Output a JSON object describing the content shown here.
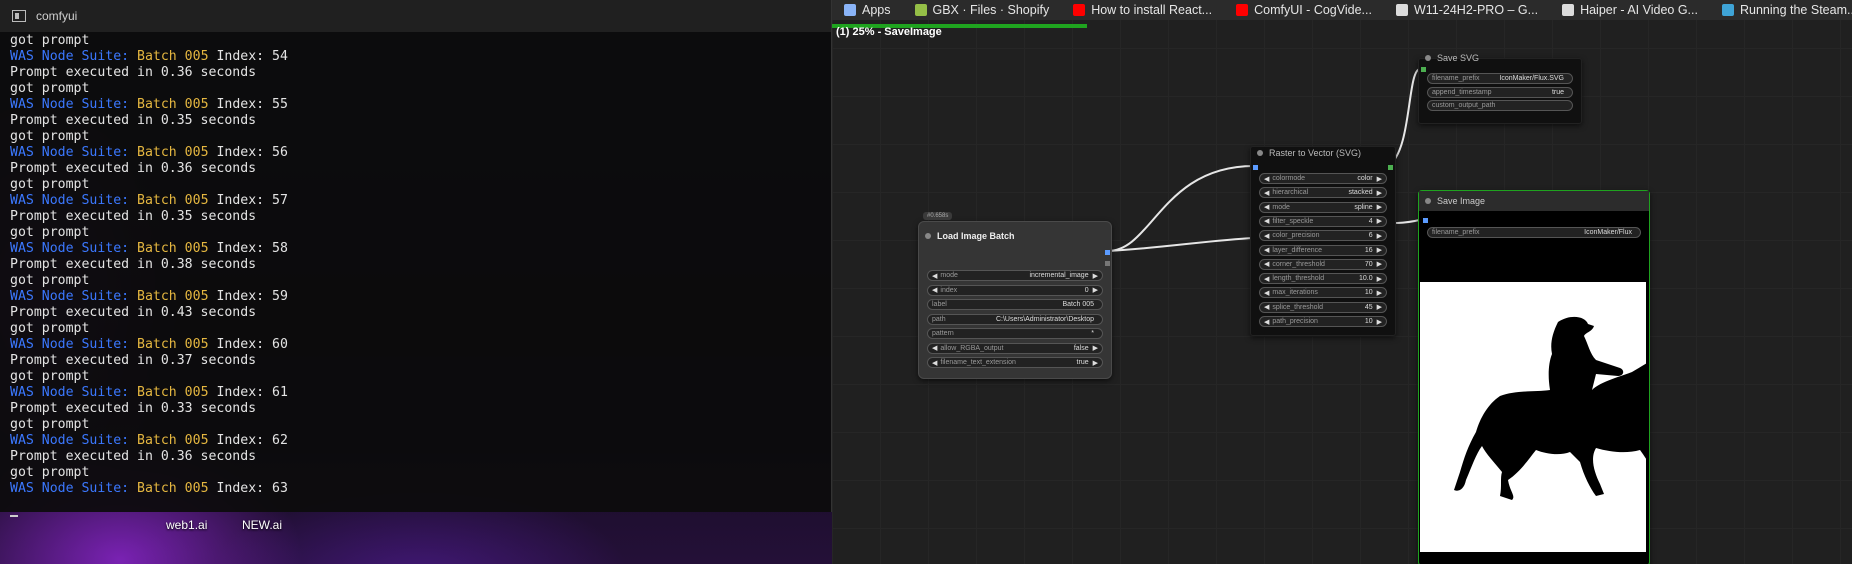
{
  "terminal": {
    "title": "comfyui",
    "log": [
      {
        "kind": "prompt",
        "text": "got prompt"
      },
      {
        "kind": "was",
        "prefix": "WAS Node Suite: ",
        "batch": "Batch 005",
        "suffix": " Index: 54"
      },
      {
        "kind": "exec",
        "text": "Prompt executed in 0.36 seconds"
      },
      {
        "kind": "prompt",
        "text": "got prompt"
      },
      {
        "kind": "was",
        "prefix": "WAS Node Suite: ",
        "batch": "Batch 005",
        "suffix": " Index: 55"
      },
      {
        "kind": "exec",
        "text": "Prompt executed in 0.35 seconds"
      },
      {
        "kind": "prompt",
        "text": "got prompt"
      },
      {
        "kind": "was",
        "prefix": "WAS Node Suite: ",
        "batch": "Batch 005",
        "suffix": " Index: 56"
      },
      {
        "kind": "exec",
        "text": "Prompt executed in 0.36 seconds"
      },
      {
        "kind": "prompt",
        "text": "got prompt"
      },
      {
        "kind": "was",
        "prefix": "WAS Node Suite: ",
        "batch": "Batch 005",
        "suffix": " Index: 57"
      },
      {
        "kind": "exec",
        "text": "Prompt executed in 0.35 seconds"
      },
      {
        "kind": "prompt",
        "text": "got prompt"
      },
      {
        "kind": "was",
        "prefix": "WAS Node Suite: ",
        "batch": "Batch 005",
        "suffix": " Index: 58"
      },
      {
        "kind": "exec",
        "text": "Prompt executed in 0.38 seconds"
      },
      {
        "kind": "prompt",
        "text": "got prompt"
      },
      {
        "kind": "was",
        "prefix": "WAS Node Suite: ",
        "batch": "Batch 005",
        "suffix": " Index: 59"
      },
      {
        "kind": "exec",
        "text": "Prompt executed in 0.43 seconds"
      },
      {
        "kind": "prompt",
        "text": "got prompt"
      },
      {
        "kind": "was",
        "prefix": "WAS Node Suite: ",
        "batch": "Batch 005",
        "suffix": " Index: 60"
      },
      {
        "kind": "exec",
        "text": "Prompt executed in 0.37 seconds"
      },
      {
        "kind": "prompt",
        "text": "got prompt"
      },
      {
        "kind": "was",
        "prefix": "WAS Node Suite: ",
        "batch": "Batch 005",
        "suffix": " Index: 61"
      },
      {
        "kind": "exec",
        "text": "Prompt executed in 0.33 seconds"
      },
      {
        "kind": "prompt",
        "text": "got prompt"
      },
      {
        "kind": "was",
        "prefix": "WAS Node Suite: ",
        "batch": "Batch 005",
        "suffix": " Index: 62"
      },
      {
        "kind": "exec",
        "text": "Prompt executed in 0.36 seconds"
      },
      {
        "kind": "prompt",
        "text": "got prompt"
      },
      {
        "kind": "was",
        "prefix": "WAS Node Suite: ",
        "batch": "Batch 005",
        "suffix": " Index: 63"
      }
    ],
    "colors": {
      "was": "#3b78ff",
      "batch": "#e5b740",
      "text": "#e4e4e4"
    }
  },
  "desktop": {
    "icons": [
      "web1.ai",
      "NEW.ai"
    ]
  },
  "bookmarks": [
    {
      "label": "Apps",
      "icon": "apps-grid-icon",
      "color": "#8ab4f8"
    },
    {
      "label": "GBX · Files · Shopify",
      "icon": "shopify-icon",
      "color": "#95bf47"
    },
    {
      "label": "How to install React...",
      "icon": "youtube-icon",
      "color": "#ff0000"
    },
    {
      "label": "ComfyUI - CogVide...",
      "icon": "youtube-icon",
      "color": "#ff0000"
    },
    {
      "label": "W11-24H2-PRO – G...",
      "icon": "github-icon",
      "color": "#dddddd"
    },
    {
      "label": "Haiper - AI Video G...",
      "icon": "haiper-icon",
      "color": "#dddddd"
    },
    {
      "label": "Running the Steam...",
      "icon": "wordpress-icon",
      "color": "#3fa4d6"
    }
  ],
  "queue": {
    "status": "(1) 25% - SaveImage",
    "progress": 0.25
  },
  "nodes": {
    "load_image_batch": {
      "badge": "#0.658s",
      "title": "Load Image Batch",
      "widgets": [
        {
          "name": "mode",
          "value": "incremental_image",
          "arrows": true
        },
        {
          "name": "index",
          "value": "0",
          "arrows": true
        },
        {
          "name": "label",
          "value": "Batch 005",
          "arrows": false
        },
        {
          "name": "path",
          "value": "C:\\Users\\Administrator\\Desktop",
          "arrows": false
        },
        {
          "name": "pattern",
          "value": "*",
          "arrows": false
        },
        {
          "name": "allow_RGBA_output",
          "value": "false",
          "arrows": true
        },
        {
          "name": "filename_text_extension",
          "value": "true",
          "arrows": true
        }
      ]
    },
    "raster_to_vector": {
      "title": "Raster to Vector (SVG)",
      "widgets": [
        {
          "name": "colormode",
          "value": "color"
        },
        {
          "name": "hierarchical",
          "value": "stacked"
        },
        {
          "name": "mode",
          "value": "spline"
        },
        {
          "name": "filter_speckle",
          "value": "4"
        },
        {
          "name": "color_precision",
          "value": "6"
        },
        {
          "name": "layer_difference",
          "value": "16"
        },
        {
          "name": "corner_threshold",
          "value": "70"
        },
        {
          "name": "length_threshold",
          "value": "10.0"
        },
        {
          "name": "max_iterations",
          "value": "10"
        },
        {
          "name": "splice_threshold",
          "value": "45"
        },
        {
          "name": "path_precision",
          "value": "10"
        }
      ]
    },
    "save_svg": {
      "title": "Save SVG",
      "widgets": [
        {
          "name": "filename_prefix",
          "value": "IconMaker/Flux.SVG"
        },
        {
          "name": "append_timestamp",
          "value": "true"
        },
        {
          "name": "custom_output_path",
          "value": ""
        }
      ]
    },
    "save_image": {
      "title": "Save Image",
      "widgets": [
        {
          "name": "filename_prefix",
          "value": "IconMaker/Flux"
        }
      ]
    }
  }
}
